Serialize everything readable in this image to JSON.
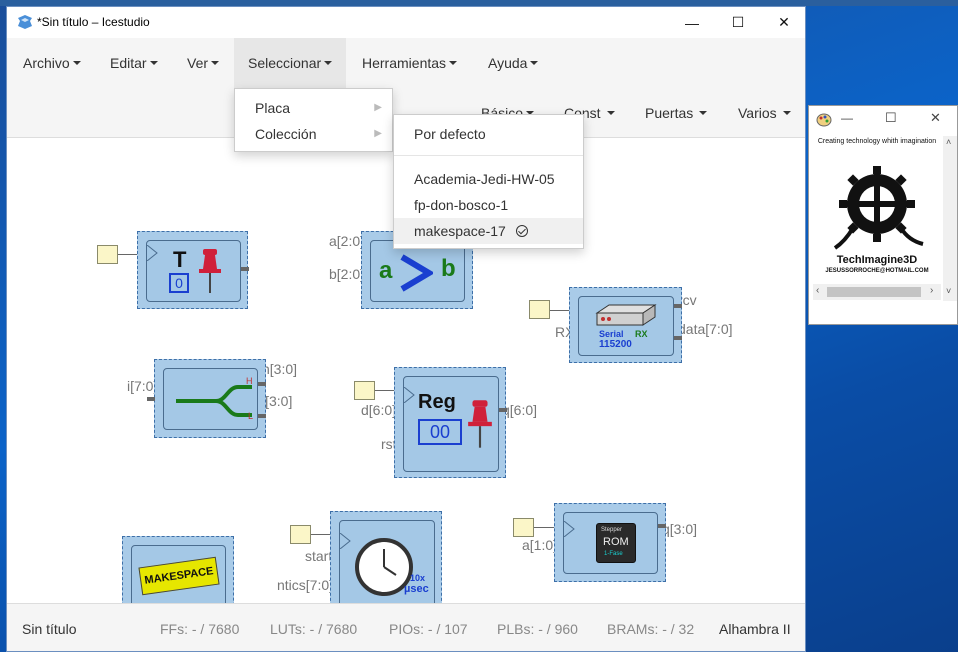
{
  "window": {
    "title": "*Sin título – Icestudio",
    "minimize": "—",
    "maximize": "☐",
    "close": "✕"
  },
  "menubar": {
    "items": [
      {
        "label": "Archivo"
      },
      {
        "label": "Editar"
      },
      {
        "label": "Ver"
      },
      {
        "label": "Seleccionar"
      },
      {
        "label": "Herramientas"
      },
      {
        "label": "Ayuda"
      }
    ]
  },
  "toolbar2": {
    "items": [
      {
        "label": "Básico"
      },
      {
        "label": "Const"
      },
      {
        "label": "Puertas"
      },
      {
        "label": "Varios"
      }
    ]
  },
  "select_menu": {
    "items": [
      {
        "label": "Placa"
      },
      {
        "label": "Colección"
      }
    ]
  },
  "coleccion_menu": {
    "default": "Por defecto",
    "items": [
      {
        "label": "Academia-Jedi-HW-05"
      },
      {
        "label": "fp-don-bosco-1"
      },
      {
        "label": "makespace-17",
        "selected": true
      }
    ]
  },
  "blocks": {
    "toggle": {
      "title": "T",
      "value": "0"
    },
    "comparator": {
      "in_a": "a[2:0]",
      "in_b": "b[2:0]",
      "a": "a",
      "b": "b"
    },
    "serial_rx": {
      "in_rx": "RX",
      "out_rcv": "rcv",
      "out_data": "data[7:0]",
      "label1": "Serial",
      "label2": "RX",
      "baud": "115200"
    },
    "splitter": {
      "in_i": "i[7:0]",
      "out_h": "h[3:0]",
      "out_l": "l[3:0]",
      "mark_h": "H",
      "mark_l": "L"
    },
    "reg": {
      "title": "Reg",
      "value": "00",
      "in_d": "d[6:0]",
      "in_rst": "rst",
      "out_q": "q[6:0]"
    },
    "makespace": {
      "label": "MAKESPACE"
    },
    "timer": {
      "in_start": "start",
      "in_ntics": "ntics[7:0]",
      "mult": "10x",
      "unit": "µsec"
    },
    "rom": {
      "in_a": "a[1:0]",
      "out_q": "q[3:0]",
      "line1": "Stepper",
      "line2": "ROM",
      "line3": "1-Fase"
    }
  },
  "status": {
    "filename": "Sin título",
    "ffs": "FFs:  - / 7680",
    "luts": "LUTs:  - / 7680",
    "pios": "PIOs:  - / 107",
    "plbs": "PLBs:  - / 960",
    "brams": "BRAMs:  - / 32",
    "board": "Alhambra II"
  },
  "tools_window": {
    "logo_arc": "Creating technology whith imagination",
    "logo_name": "TechImagine3D",
    "logo_email": "JESUSSORROCHE@HOTMAIL.COM",
    "minimize": "—",
    "maximize": "☐",
    "close": "✕"
  },
  "colors": {
    "accent_blue": "#0a58b6",
    "block_fill": "#a4c8e6",
    "input_fill": "#fbf6c8"
  }
}
